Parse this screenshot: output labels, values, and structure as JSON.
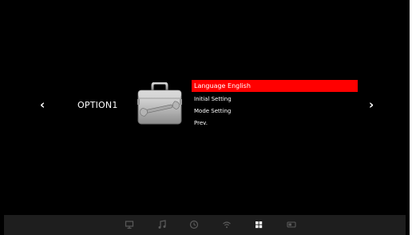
{
  "nav": {
    "prev_arrow": "‹",
    "next_arrow": "›"
  },
  "option": {
    "title": "OPTION1"
  },
  "menu": {
    "items": [
      {
        "label": "Language English",
        "selected": true
      },
      {
        "label": "Initial Setting",
        "selected": false
      },
      {
        "label": "Mode Setting",
        "selected": false
      },
      {
        "label": "Prev.",
        "selected": false
      }
    ]
  },
  "bottom_bar": {
    "icons": [
      {
        "name": "monitor-icon",
        "active": false
      },
      {
        "name": "music-note-icon",
        "active": false
      },
      {
        "name": "clock-icon",
        "active": false
      },
      {
        "name": "wifi-icon",
        "active": false
      },
      {
        "name": "grid-icon",
        "active": true
      },
      {
        "name": "card-icon",
        "active": false
      }
    ]
  },
  "colors": {
    "background": "#000000",
    "highlight": "#ff0000",
    "text": "#ffffff",
    "bar": "#1e1e1e",
    "icon_dim": "#5a5a5a",
    "icon_active": "#ffffff"
  }
}
